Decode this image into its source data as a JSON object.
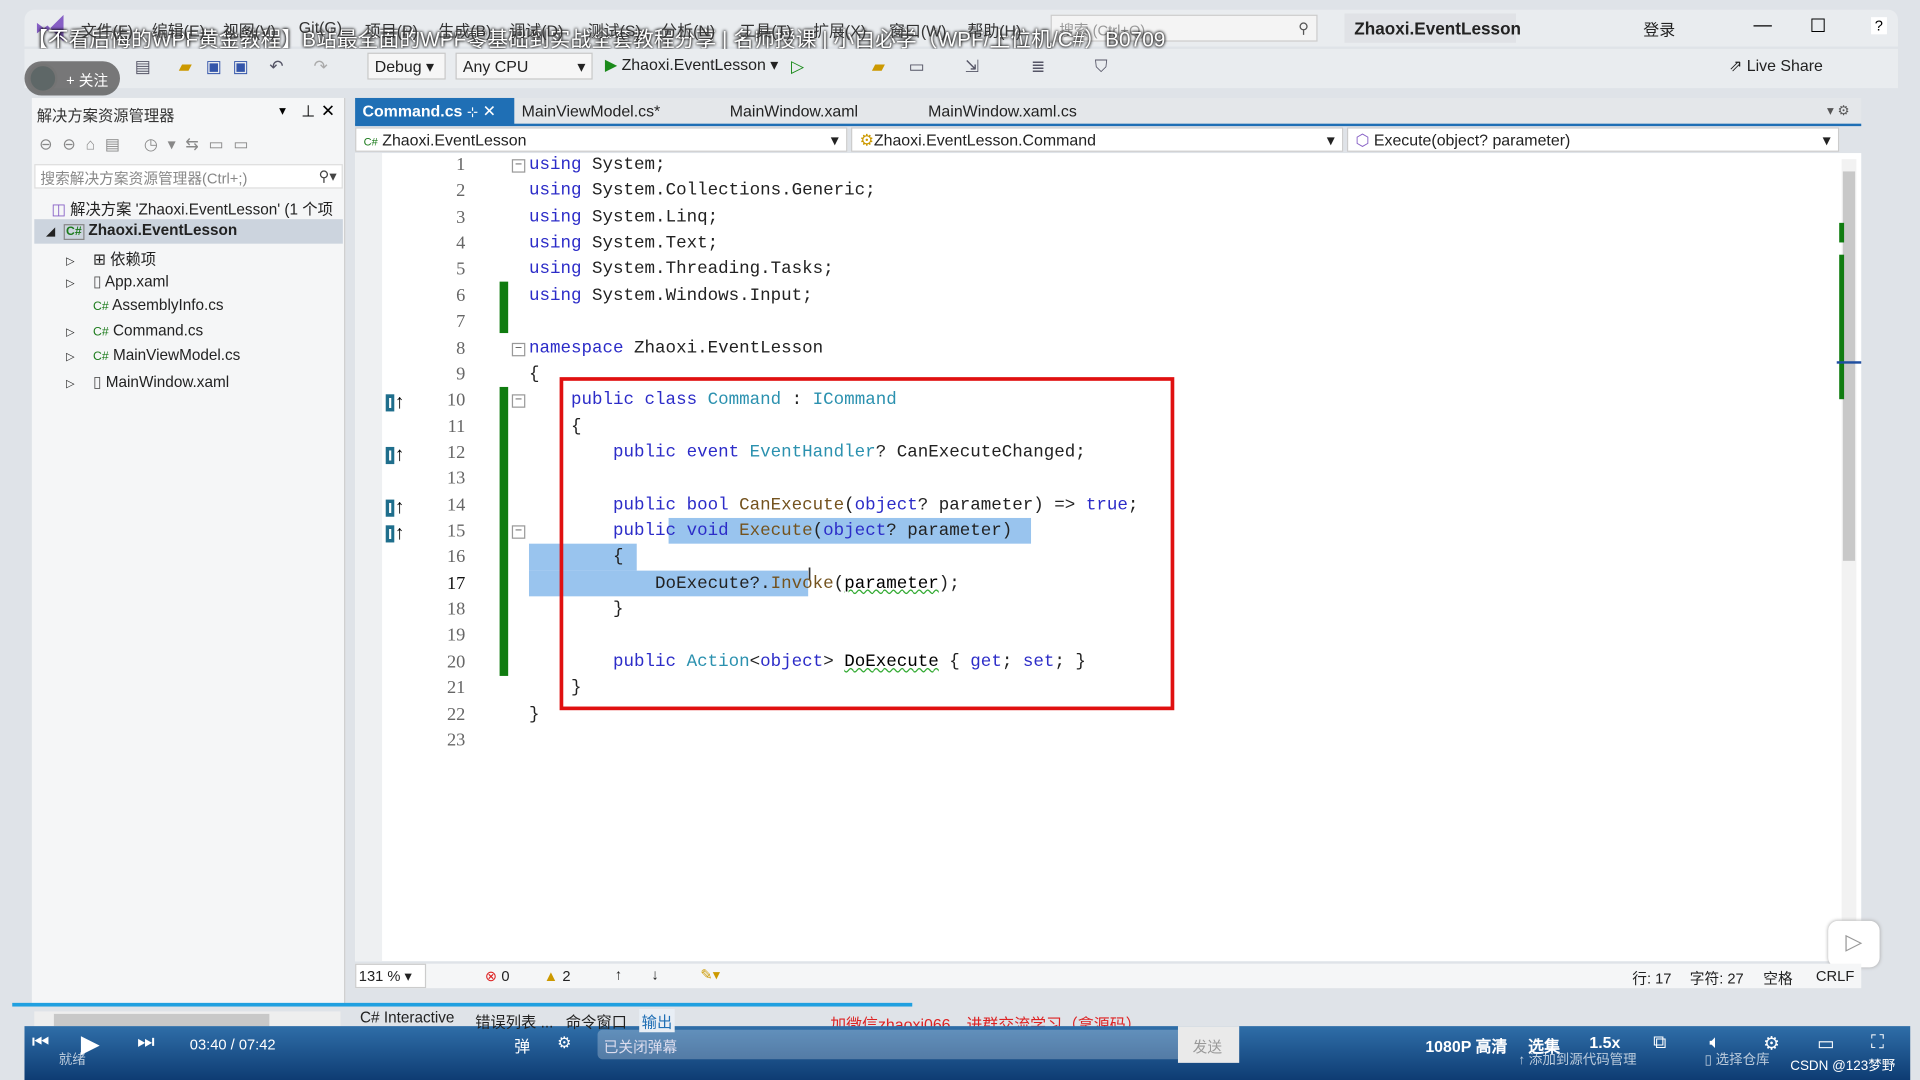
{
  "video_title": "【不看后悔的WPF黄金教程】B站最全面的WPF零基础到实战全套教程分享 | 名师授课 | 小白必学（WPF/上位机/C#）B0709",
  "menu": [
    "文件(F)",
    "编辑(E)",
    "视图(V)",
    "Git(G)",
    "项目(P)",
    "生成(B)",
    "调试(D)",
    "测试(S)",
    "分析(N)",
    "工具(T)",
    "扩展(X)",
    "窗口(W)",
    "帮助(H)"
  ],
  "search_placeholder": "搜索 (Ctrl+Q)",
  "project_title": "Zhaoxi.EventLesson",
  "login": "登录",
  "toolbar": {
    "config": "Debug",
    "platform": "Any CPU",
    "run_target": "Zhaoxi.EventLesson",
    "live_share": "Live Share"
  },
  "follow_label": "+ 关注",
  "solution_explorer": {
    "title": "解决方案资源管理器",
    "search_placeholder": "搜索解决方案资源管理器(Ctrl+;)",
    "solution": "解决方案 'Zhaoxi.EventLesson' (1 个项",
    "project": "Zhaoxi.EventLesson",
    "items": [
      {
        "label": "依赖项",
        "icon": "dependencies-icon",
        "expandable": true
      },
      {
        "label": "App.xaml",
        "icon": "xaml-file-icon",
        "expandable": true
      },
      {
        "label": "AssemblyInfo.cs",
        "icon": "csharp-file-icon",
        "expandable": false
      },
      {
        "label": "Command.cs",
        "icon": "csharp-file-icon",
        "expandable": true
      },
      {
        "label": "MainViewModel.cs",
        "icon": "csharp-file-icon",
        "expandable": true
      },
      {
        "label": "MainWindow.xaml",
        "icon": "xaml-file-icon",
        "expandable": true
      }
    ]
  },
  "tabs": [
    {
      "label": "Command.cs",
      "active": true
    },
    {
      "label": "MainViewModel.cs*",
      "active": false
    },
    {
      "label": "MainWindow.xaml",
      "active": false
    },
    {
      "label": "MainWindow.xaml.cs",
      "active": false
    }
  ],
  "navbar": {
    "project": "Zhaoxi.EventLesson",
    "type": "Zhaoxi.EventLesson.Command",
    "member": "Execute(object? parameter)"
  },
  "code_lines": [
    [
      [
        "using",
        "kw"
      ],
      [
        " System;",
        "pl"
      ]
    ],
    [
      [
        "using",
        "kw"
      ],
      [
        " System.Collections.Generic;",
        "pl"
      ]
    ],
    [
      [
        "using",
        "kw"
      ],
      [
        " System.Linq;",
        "pl"
      ]
    ],
    [
      [
        "using",
        "kw"
      ],
      [
        " System.Text;",
        "pl"
      ]
    ],
    [
      [
        "using",
        "kw"
      ],
      [
        " System.Threading.Tasks;",
        "pl"
      ]
    ],
    [
      [
        "using",
        "kw"
      ],
      [
        " System.Windows.Input;",
        "pl"
      ]
    ],
    [],
    [
      [
        "namespace",
        "kw"
      ],
      [
        " Zhaoxi.EventLesson",
        "pl"
      ]
    ],
    [
      [
        "{",
        "pl"
      ]
    ],
    [
      [
        "    public class ",
        "kw"
      ],
      [
        "Command",
        "ty"
      ],
      [
        " : ",
        "pl"
      ],
      [
        "ICommand",
        "ty"
      ]
    ],
    [
      [
        "    {",
        "pl"
      ]
    ],
    [
      [
        "        public event ",
        "kw"
      ],
      [
        "EventHandler",
        "ty"
      ],
      [
        "? CanExecuteChanged;",
        "pl"
      ]
    ],
    [],
    [
      [
        "        public bool ",
        "kw"
      ],
      [
        "CanExecute",
        "me"
      ],
      [
        "(",
        "pl"
      ],
      [
        "object",
        "kw"
      ],
      [
        "? parameter) => ",
        "pl"
      ],
      [
        "true",
        "kw"
      ],
      [
        ";",
        "pl"
      ]
    ],
    [
      [
        "        public void ",
        "kw"
      ],
      [
        "Execute",
        "me"
      ],
      [
        "(",
        "pl"
      ],
      [
        "object",
        "kw"
      ],
      [
        "? parameter)",
        "pl"
      ]
    ],
    [
      [
        "        {",
        "pl"
      ]
    ],
    [
      [
        "            DoExecute?.",
        "pl"
      ],
      [
        "Invoke",
        "me"
      ],
      [
        "(",
        "pl"
      ],
      [
        "parameter",
        "sq"
      ],
      [
        ");",
        "pl"
      ]
    ],
    [
      [
        "        }",
        "pl"
      ]
    ],
    [],
    [
      [
        "        public ",
        "kw"
      ],
      [
        "Action",
        "ty"
      ],
      [
        "<",
        "pl"
      ],
      [
        "object",
        "kw"
      ],
      [
        "> ",
        "pl"
      ],
      [
        "DoExecute",
        "sq"
      ],
      [
        " { ",
        "pl"
      ],
      [
        "get",
        "kw"
      ],
      [
        "; ",
        "pl"
      ],
      [
        "set",
        "kw"
      ],
      [
        "; }",
        "pl"
      ]
    ],
    [
      [
        "    }",
        "pl"
      ]
    ],
    [
      [
        "}",
        "pl"
      ]
    ],
    []
  ],
  "status": {
    "zoom": "131 %",
    "errors": "0",
    "warnings": "2",
    "line": "行: 17",
    "char": "字符: 27",
    "spaces": "空格",
    "eol": "CRLF"
  },
  "bottom_tabs": [
    "C# Interactive",
    "错误列表 ...",
    "命令窗口",
    "输出"
  ],
  "promo": "加微信zhaoxi066，进群交流学习（拿源码）",
  "player": {
    "time": "03:40 / 07:42",
    "danmu_placeholder": "已关闭弹幕",
    "send": "发送",
    "quality": "1080P 高清",
    "episodes": "选集",
    "speed": "1.5x",
    "progress_percent": 47.6
  },
  "vs_status": {
    "ready": "就绪",
    "source_control": "添加到源代码管理",
    "repo": "选择仓库"
  },
  "watermark": "CSDN @123梦野"
}
